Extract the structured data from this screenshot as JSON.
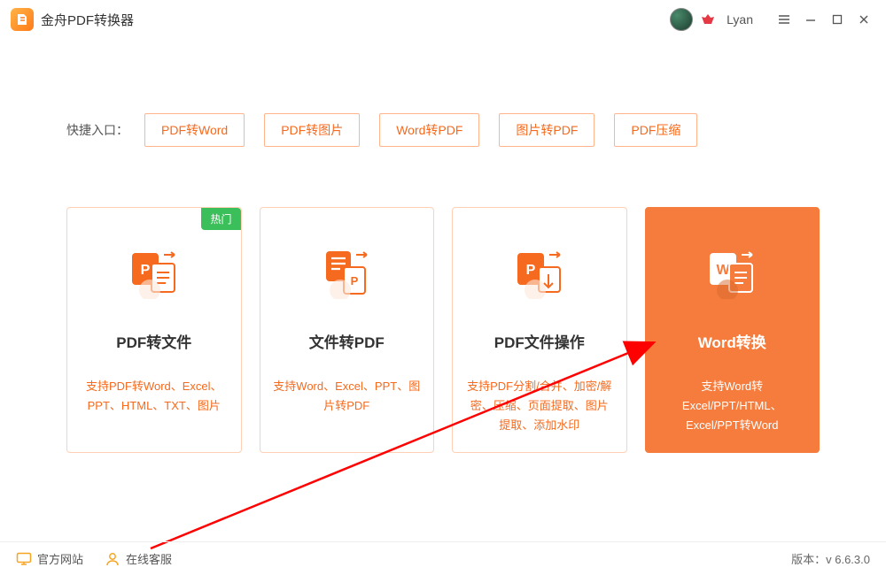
{
  "app": {
    "title": "金舟PDF转换器",
    "username": "Lyan"
  },
  "quick": {
    "label": "快捷入口：",
    "items": [
      "PDF转Word",
      "PDF转图片",
      "Word转PDF",
      "图片转PDF",
      "PDF压缩"
    ]
  },
  "cards": [
    {
      "title": "PDF转文件",
      "desc": "支持PDF转Word、Excel、PPT、HTML、TXT、图片",
      "badge": "热门",
      "active": false
    },
    {
      "title": "文件转PDF",
      "desc": "支持Word、Excel、PPT、图片转PDF",
      "badge": null,
      "active": false
    },
    {
      "title": "PDF文件操作",
      "desc": "支持PDF分割/合并、加密/解密、压缩、页面提取、图片提取、添加水印",
      "badge": null,
      "active": false
    },
    {
      "title": "Word转换",
      "desc": "支持Word转Excel/PPT/HTML、Excel/PPT转Word",
      "badge": null,
      "active": true
    }
  ],
  "footer": {
    "official_site": "官方网站",
    "online_support": "在线客服",
    "version_label": "版本：",
    "version": "v 6.6.3.0"
  }
}
